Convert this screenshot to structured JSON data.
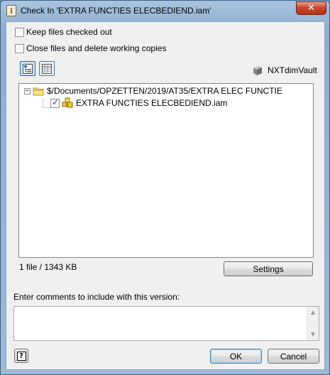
{
  "window": {
    "title": "Check In 'EXTRA FUNCTIES ELECBEDIEND.iam'",
    "close_glyph": "✕",
    "app_icon_glyph": "I"
  },
  "options": {
    "keep_checked_out": {
      "label": "Keep files checked out",
      "checked": false
    },
    "close_files": {
      "label": "Close files and delete working copies",
      "checked": false
    }
  },
  "vault": {
    "name": "NXTdimVault",
    "icon": "vault-server-icon"
  },
  "tree": {
    "root": {
      "expander": "−",
      "label": "$/Documents/OPZETTEN/2019/AT35/EXTRA ELEC FUNCTIE"
    },
    "file": {
      "label": "EXTRA FUNCTIES ELECBEDIEND.iam",
      "checked": true
    }
  },
  "status": {
    "summary": "1 file / 1343 KB"
  },
  "buttons": {
    "settings": "Settings",
    "ok": "OK",
    "cancel": "Cancel",
    "help_glyph": "?"
  },
  "comments": {
    "label": "Enter comments to include with this version:",
    "value": "",
    "scroll_up": "▲",
    "scroll_down": "▼"
  },
  "colors": {
    "title_bar": "#9bb9d8",
    "close_button": "#c7482f",
    "selection_blue": "#3d7bc2"
  }
}
